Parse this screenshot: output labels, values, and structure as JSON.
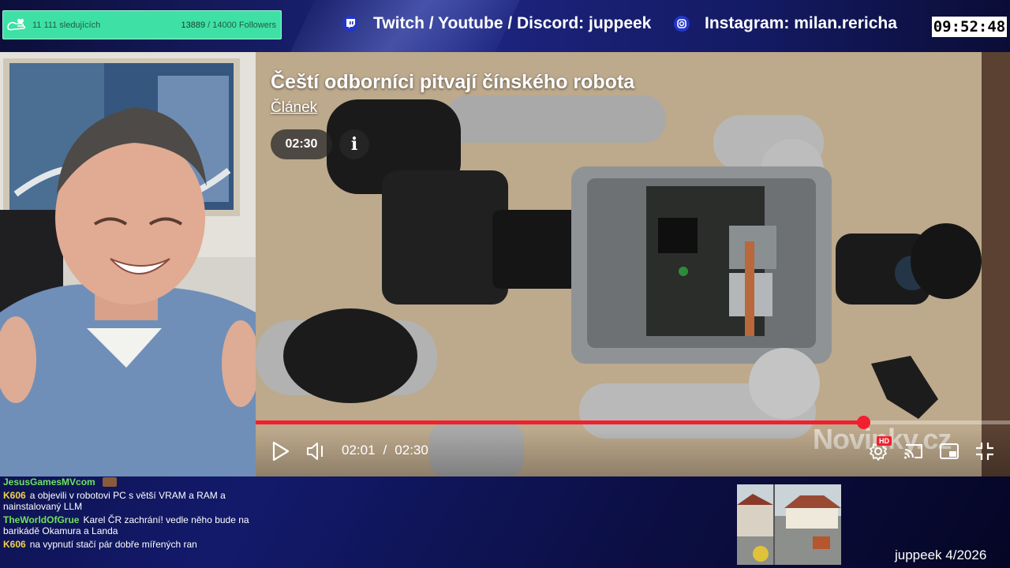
{
  "overlay": {
    "follower_goal": {
      "label": "11 111 sledujících",
      "current": "13889",
      "target_text": "/ 14000 Followers"
    },
    "socials": [
      {
        "icon": "twitch-icon",
        "text": "Twitch / Youtube / Discord: juppeek"
      },
      {
        "icon": "instagram-icon",
        "text": "Instagram: milan.rericha"
      }
    ],
    "clock": "09:52:48",
    "footer_tag": "juppeek 4/2026",
    "colors": {
      "goal_bg": "#3fe0a6",
      "progress": "#f21f2e",
      "user_green": "#6ee35a",
      "user_yellow": "#f2d24a"
    }
  },
  "player": {
    "title": "Čeští odborníci pitvají čínského robota",
    "link_label": "Článek",
    "duration_badge": "02:30",
    "info_label": "i",
    "current_time": "02:01",
    "time_separator": "/",
    "total_time": "02:30",
    "progress_fraction": 0.805,
    "watermark": "Novinky.cz",
    "hd_badge": "HD",
    "controls": [
      "play-icon",
      "volume-icon",
      "settings-icon",
      "cast-icon",
      "miniplayer-icon",
      "exit-fullscreen-icon"
    ]
  },
  "chat": {
    "messages": [
      {
        "user": "JesusGamesMVcom",
        "color": "green",
        "text": "",
        "emote": true
      },
      {
        "user": "K606",
        "color": "yellow",
        "text": "a objevili v robotovi PC s větší VRAM a RAM a nainstalovaný LLM"
      },
      {
        "user": "TheWorldOfGrue",
        "color": "green",
        "text": "Karel ČR zachrání! vedle něho bude na barikádě Okamura a Landa"
      },
      {
        "user": "K606",
        "color": "yellow",
        "text": "na vypnutí stačí pár dobře mířených ran"
      }
    ]
  }
}
